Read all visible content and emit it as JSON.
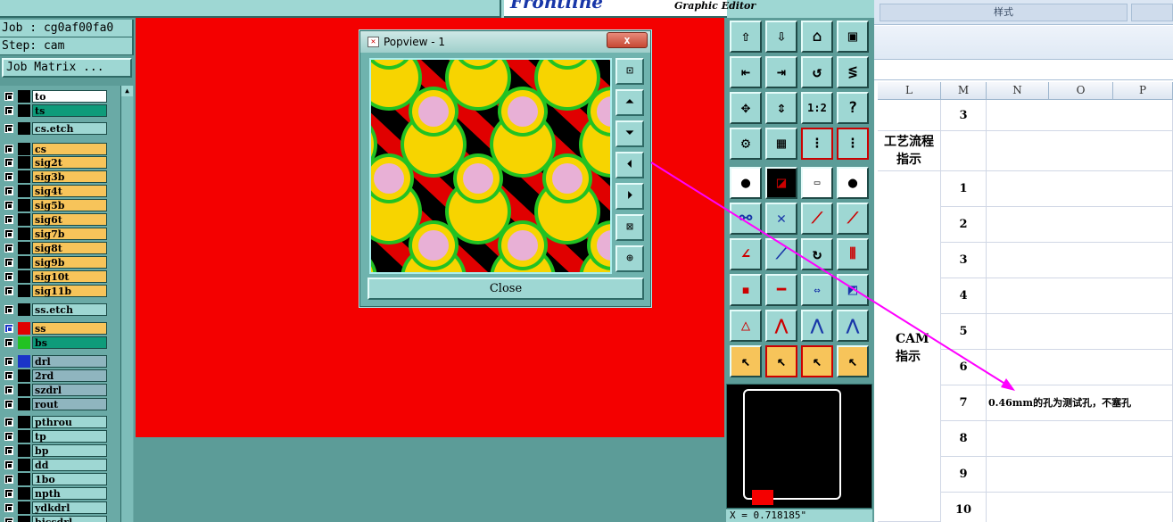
{
  "genesis": {
    "brand": "Frontline",
    "subtitle": "Graphic Editor",
    "job_line": "Job : cg0af00fa0",
    "step_line": "Step: cam",
    "job_matrix_label": "Job Matrix ...",
    "layers": [
      {
        "name": "to",
        "color": "#ffffff"
      },
      {
        "name": "ts",
        "color": "#0e9b7a"
      },
      {
        "name": "cs.etch",
        "color": "#9ed7d3"
      },
      {
        "name": "cs",
        "color": "#f7c45a"
      },
      {
        "name": "sig2t",
        "color": "#f7c45a"
      },
      {
        "name": "sig3b",
        "color": "#f7c45a"
      },
      {
        "name": "sig4t",
        "color": "#f7c45a"
      },
      {
        "name": "sig5b",
        "color": "#f7c45a"
      },
      {
        "name": "sig6t",
        "color": "#f7c45a"
      },
      {
        "name": "sig7b",
        "color": "#f7c45a"
      },
      {
        "name": "sig8t",
        "color": "#f7c45a"
      },
      {
        "name": "sig9b",
        "color": "#f7c45a"
      },
      {
        "name": "sig10t",
        "color": "#f7c45a"
      },
      {
        "name": "sig11b",
        "color": "#f7c45a"
      },
      {
        "name": "ss.etch",
        "color": "#9ed7d3"
      },
      {
        "name": "ss",
        "color": "#f7c45a"
      },
      {
        "name": "bs",
        "color": "#0e9b7a"
      },
      {
        "name": "drl",
        "color": "#8fb5bf"
      },
      {
        "name": "2rd",
        "color": "#8fb5bf"
      },
      {
        "name": "szdrl",
        "color": "#8fb5bf"
      },
      {
        "name": "rout",
        "color": "#8fb5bf"
      },
      {
        "name": "pthrou",
        "color": "#9ed7d3"
      },
      {
        "name": "tp",
        "color": "#9ed7d3"
      },
      {
        "name": "bp",
        "color": "#9ed7d3"
      },
      {
        "name": "dd",
        "color": "#9ed7d3"
      },
      {
        "name": "1bo",
        "color": "#9ed7d3"
      },
      {
        "name": "npth",
        "color": "#9ed7d3"
      },
      {
        "name": "ydkdrl",
        "color": "#9ed7d3"
      },
      {
        "name": "bjcsdrl",
        "color": "#9ed7d3"
      }
    ],
    "popview": {
      "title": "Popview - 1",
      "close_x": "x",
      "close_label": "Close"
    },
    "coordinate_text": "X = 0.718185\""
  },
  "excel": {
    "ribbon_group": "样式",
    "columns": [
      "L",
      "M",
      "N",
      "O",
      "P"
    ],
    "row_numbers": [
      "3",
      "1",
      "2",
      "3",
      "4",
      "5",
      "6",
      "7",
      "8",
      "9",
      "10"
    ],
    "label_process": "工艺流程指示",
    "label_process_l1": "工艺流程",
    "label_process_l2": "指示",
    "label_cam_l1": "CAM",
    "label_cam_l2": "指示",
    "note_row7": "0.46mm的孔为测试孔，不塞孔"
  }
}
